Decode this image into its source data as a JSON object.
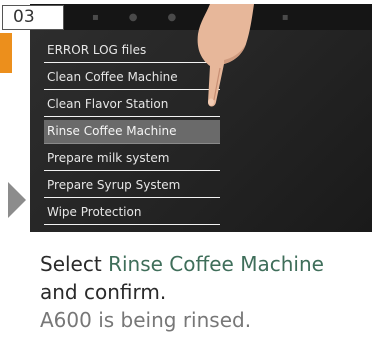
{
  "step_number": "03",
  "menu": {
    "items": [
      "ERROR LOG files",
      "Clean Coffee Machine",
      "Clean Flavor Station",
      "Rinse Coffee Machine",
      "Prepare milk system",
      "Prepare Syrup System",
      "Wipe Protection"
    ],
    "selected_index": 3
  },
  "instruction": {
    "line1_prefix": "Select ",
    "line1_highlight": "Rinse Coffee Machine",
    "line2": "and confirm.",
    "line3": "A600 is being rinsed."
  },
  "colors": {
    "accent_tab": "#ec8f1c",
    "highlight_text": "#3f6e5a",
    "selected_row": "#6a6a6a"
  },
  "icons": [
    "hand-pointer-icon",
    "next-arrow-icon"
  ]
}
